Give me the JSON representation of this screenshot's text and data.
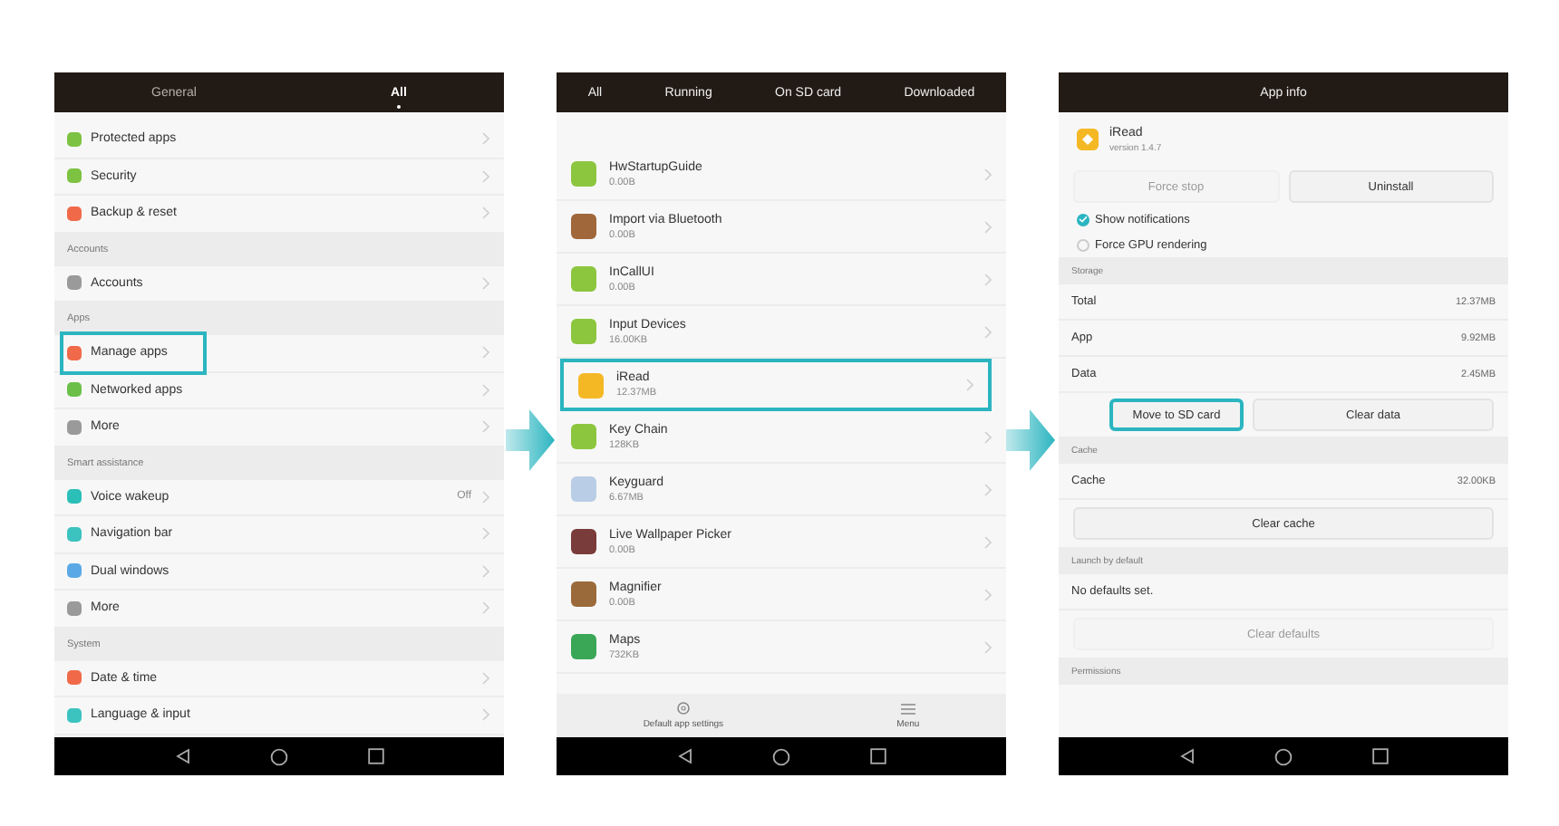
{
  "settings_screen": {
    "tabs": [
      {
        "label": "General",
        "selected": false
      },
      {
        "label": "All",
        "selected": true
      }
    ],
    "rows": [
      {
        "kind": "item",
        "label": "Protected apps",
        "color": "#7dc242",
        "highlighted": false
      },
      {
        "kind": "item",
        "label": "Security",
        "color": "#7dc242",
        "highlighted": false
      },
      {
        "kind": "item",
        "label": "Backup & reset",
        "color": "#f06a4a",
        "highlighted": false
      },
      {
        "kind": "header",
        "label": "Accounts"
      },
      {
        "kind": "item",
        "label": "Accounts",
        "color": "#9a9a9a",
        "highlighted": false
      },
      {
        "kind": "header",
        "label": "Apps"
      },
      {
        "kind": "item",
        "label": "Manage apps",
        "color": "#f06a4a",
        "highlighted": true
      },
      {
        "kind": "item",
        "label": "Networked apps",
        "color": "#6cc04a",
        "highlighted": false
      },
      {
        "kind": "item",
        "label": "More",
        "color": "#9a9a9a",
        "highlighted": false
      },
      {
        "kind": "header",
        "label": "Smart assistance"
      },
      {
        "kind": "item",
        "label": "Voice wakeup",
        "value": "Off",
        "color": "#2bbfb8",
        "highlighted": false
      },
      {
        "kind": "item",
        "label": "Navigation bar",
        "color": "#3cc3c0",
        "highlighted": false
      },
      {
        "kind": "item",
        "label": "Dual windows",
        "color": "#5aa9e6",
        "highlighted": false
      },
      {
        "kind": "item",
        "label": "More",
        "color": "#9a9a9a",
        "highlighted": false
      },
      {
        "kind": "header",
        "label": "System"
      },
      {
        "kind": "item",
        "label": "Date & time",
        "color": "#f06a4a",
        "highlighted": false
      },
      {
        "kind": "item",
        "label": "Language & input",
        "color": "#3cc3c0",
        "highlighted": false
      }
    ]
  },
  "apps_screen": {
    "tabs": [
      "All",
      "Running",
      "On SD card",
      "Downloaded"
    ],
    "apps": [
      {
        "name": "HwStartupGuide",
        "size": "0.00B",
        "color": "#8cc63f",
        "highlighted": false
      },
      {
        "name": "Import via Bluetooth",
        "size": "0.00B",
        "color": "#a0673a",
        "highlighted": false
      },
      {
        "name": "InCallUI",
        "size": "0.00B",
        "color": "#8cc63f",
        "highlighted": false
      },
      {
        "name": "Input Devices",
        "size": "16.00KB",
        "color": "#8cc63f",
        "highlighted": false
      },
      {
        "name": "iRead",
        "size": "12.37MB",
        "color": "#f5b825",
        "highlighted": true
      },
      {
        "name": "Key Chain",
        "size": "128KB",
        "color": "#8cc63f",
        "highlighted": false
      },
      {
        "name": "Keyguard",
        "size": "6.67MB",
        "color": "#b9cde6",
        "highlighted": false
      },
      {
        "name": "Live Wallpaper Picker",
        "size": "0.00B",
        "color": "#7a3b3b",
        "highlighted": false
      },
      {
        "name": "Magnifier",
        "size": "0.00B",
        "color": "#9b6a3a",
        "highlighted": false
      },
      {
        "name": "Maps",
        "size": "732KB",
        "color": "#3aa757",
        "highlighted": false
      }
    ],
    "footer": [
      {
        "kind": "settings",
        "label": "Default app settings"
      },
      {
        "kind": "menu",
        "label": "Menu"
      }
    ]
  },
  "app_info_screen": {
    "title": "App info",
    "app_name": "iRead",
    "version": "version 1.4.7",
    "action_buttons": [
      {
        "label": "Force stop",
        "disabled": true
      },
      {
        "label": "Uninstall",
        "disabled": false
      }
    ],
    "options": [
      {
        "label": "Show notifications",
        "checked": true
      },
      {
        "label": "Force GPU rendering",
        "checked": false
      }
    ],
    "storage_header": "Storage",
    "storage": [
      {
        "label": "Total",
        "value": "12.37MB"
      },
      {
        "label": "App",
        "value": "9.92MB"
      },
      {
        "label": "Data",
        "value": "2.45MB"
      }
    ],
    "storage_buttons": [
      {
        "label": "Move to SD card",
        "highlighted": true
      },
      {
        "label": "Clear data",
        "highlighted": false
      }
    ],
    "cache_header": "Cache",
    "cache": {
      "label": "Cache",
      "value": "32.00KB"
    },
    "cache_button": "Clear cache",
    "launch_header": "Launch by default",
    "launch_text": "No defaults set.",
    "launch_button": {
      "label": "Clear defaults",
      "disabled": true
    },
    "permissions_header": "Permissions"
  }
}
